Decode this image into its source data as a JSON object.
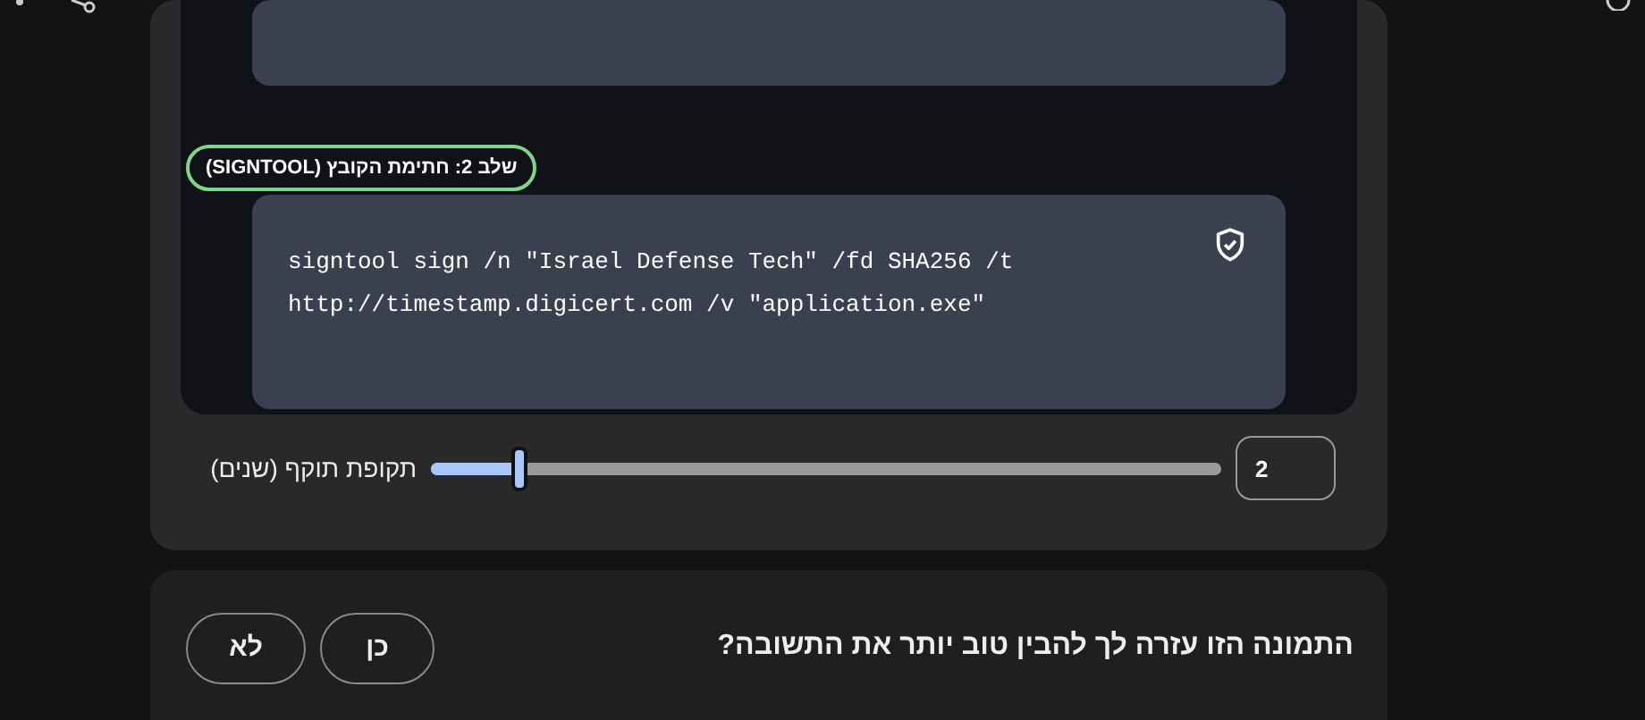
{
  "step_badge": "שלב 2: חתימת הקובץ (SIGNTOOL)",
  "code_lines": [
    "signtool sign /n \"Israel Defense Tech\" /fd SHA256 /t",
    "http://timestamp.digicert.com /v \"application.exe\""
  ],
  "validity": {
    "label": "תקופת תוקף (שנים)",
    "level": 0.11,
    "value": "2"
  },
  "feedback": {
    "question": "התמונה הזו עזרה לך להבין טוב יותר את התשובה?",
    "buttons": [
      "כן",
      "לא"
    ]
  }
}
